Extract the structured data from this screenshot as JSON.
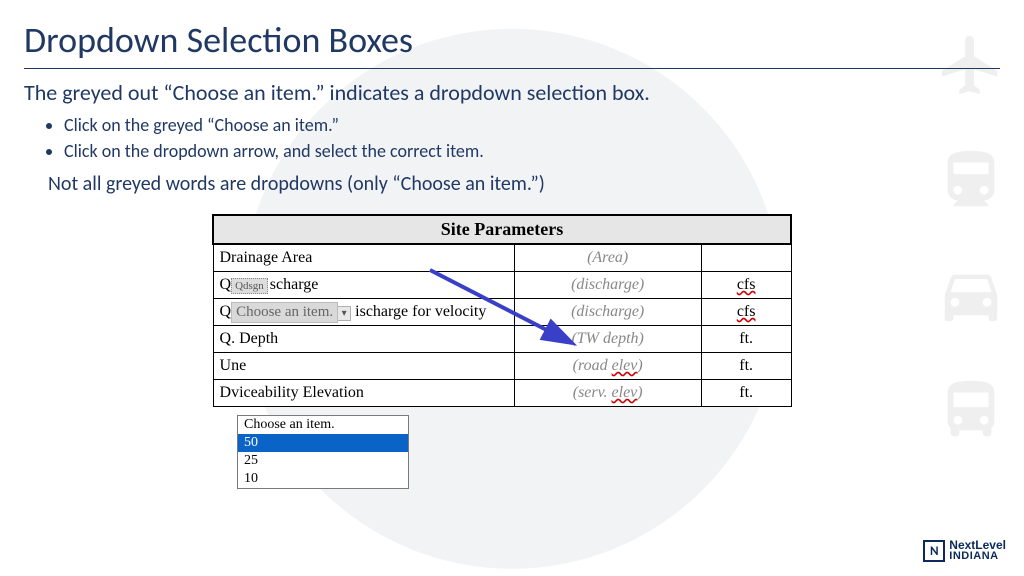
{
  "title": "Dropdown Selection Boxes",
  "intro": "The greyed out “Choose an item.” indicates a dropdown selection box.",
  "bullets": [
    "Click on the greyed “Choose an item.”",
    "Click on the dropdown arrow, and select the correct item."
  ],
  "note": "Not all greyed words are dropdowns (only “Choose an item.”)",
  "table": {
    "header": "Site Parameters",
    "rows": [
      {
        "param_pre": "Drainage Area",
        "tag": "",
        "param_post": "",
        "value": "(Area)",
        "unit": ""
      },
      {
        "param_pre": "Q",
        "tag": "Qdsgn",
        "param_post": "scharge",
        "value": "(discharge)",
        "unit": "cfs"
      },
      {
        "param_pre": "Q",
        "tag": "",
        "dd": "Choose an item.",
        "param_post": "ischarge for velocity",
        "value": "(discharge)",
        "unit": "cfs"
      },
      {
        "param_pre": "Q",
        "tag": "",
        "param_post": ". Depth",
        "value": "(TW depth)",
        "unit": "ft."
      },
      {
        "param_pre": "U",
        "tag": "",
        "param_post": "ne",
        "value": "(road elev)",
        "unit": "ft."
      },
      {
        "param_pre": "D",
        "tag": "",
        "param_post": "viceability Elevation",
        "value": "(serv. elev)",
        "unit": "ft."
      }
    ]
  },
  "dropdown": {
    "options": [
      "Choose an item.",
      "50",
      "25",
      "10"
    ],
    "highlighted": "50"
  },
  "logo": {
    "brand": "NextLevel",
    "sub": "INDIANA"
  }
}
